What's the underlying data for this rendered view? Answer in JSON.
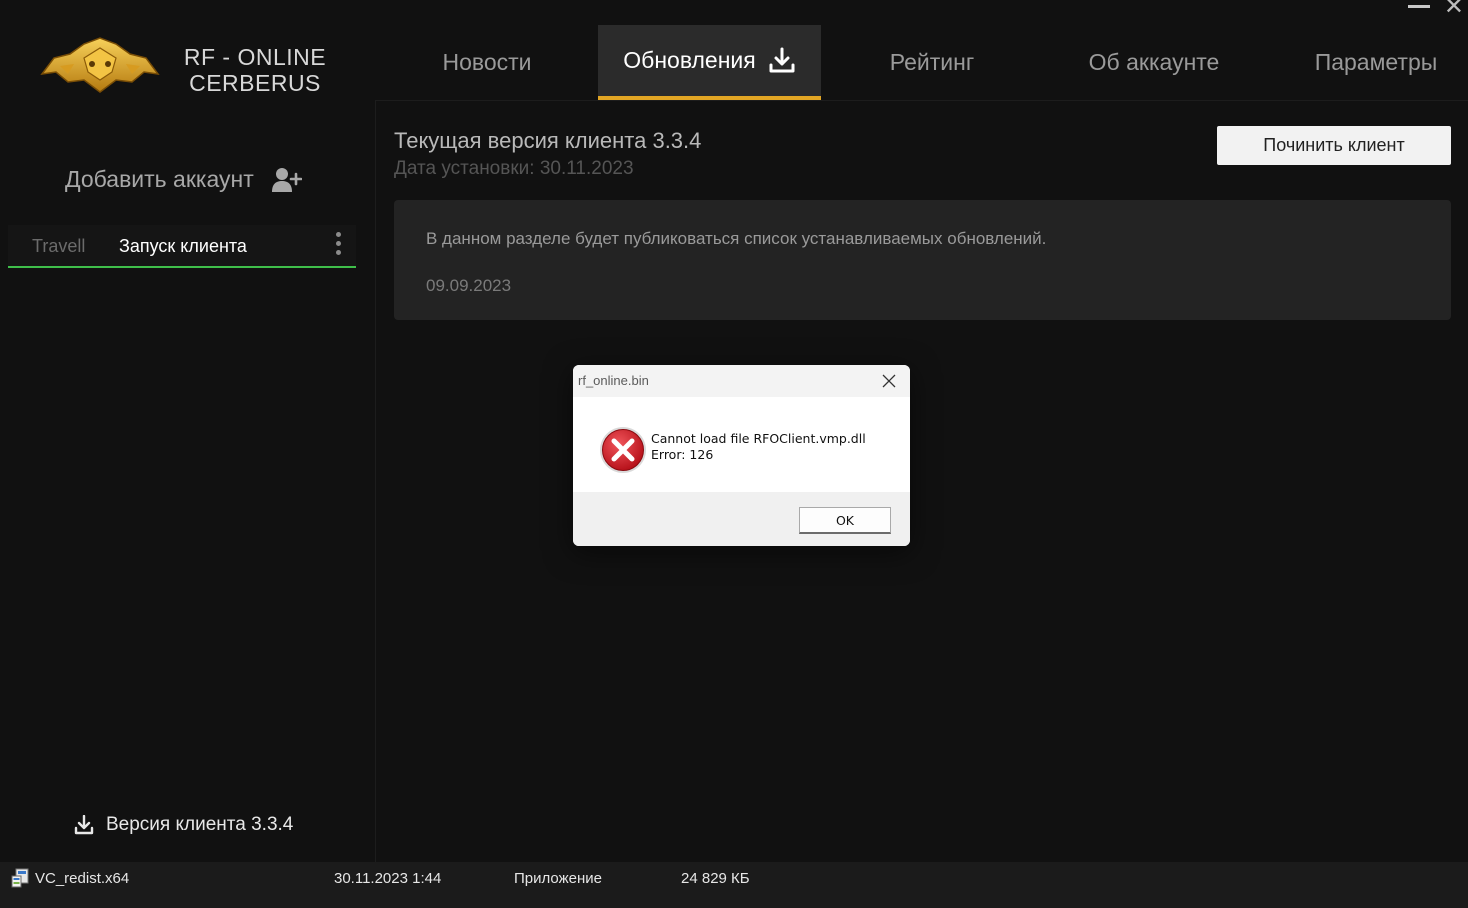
{
  "app": {
    "logo_line1": "RF - ONLINE",
    "logo_line2": "CERBERUS"
  },
  "tabs": [
    {
      "label": "Новости"
    },
    {
      "label": "Обновления",
      "active": true
    },
    {
      "label": "Рейтинг"
    },
    {
      "label": "Об аккаунте"
    },
    {
      "label": "Параметры"
    }
  ],
  "sidebar": {
    "add_account_label": "Добавить аккаунт",
    "accounts": [
      {
        "name": "Travell",
        "action": "Запуск клиента"
      }
    ],
    "client_version_label": "Версия клиента 3.3.4"
  },
  "main": {
    "current_version": "Текущая версия клиента 3.3.4",
    "install_date": "Дата установки: 30.11.2023",
    "repair_button": "Починить клиент",
    "news": {
      "text": "В данном разделе будет публиковаться список устанавливаемых обновлений.",
      "date": "09.09.2023"
    }
  },
  "dialog": {
    "title": "rf_online.bin",
    "message_line1": "Cannot load file RFOClient.vmp.dll",
    "message_line2": "Error: 126",
    "ok_label": "OK"
  },
  "file_row": {
    "name": "VC_redist.x64",
    "date": "30.11.2023 1:44",
    "type": "Приложение",
    "size": "24 829 КБ"
  },
  "colors": {
    "accent_tab": "#e3a624",
    "account_underline": "#3fbf4a",
    "background": "#111111",
    "error_red": "#d0121c"
  }
}
